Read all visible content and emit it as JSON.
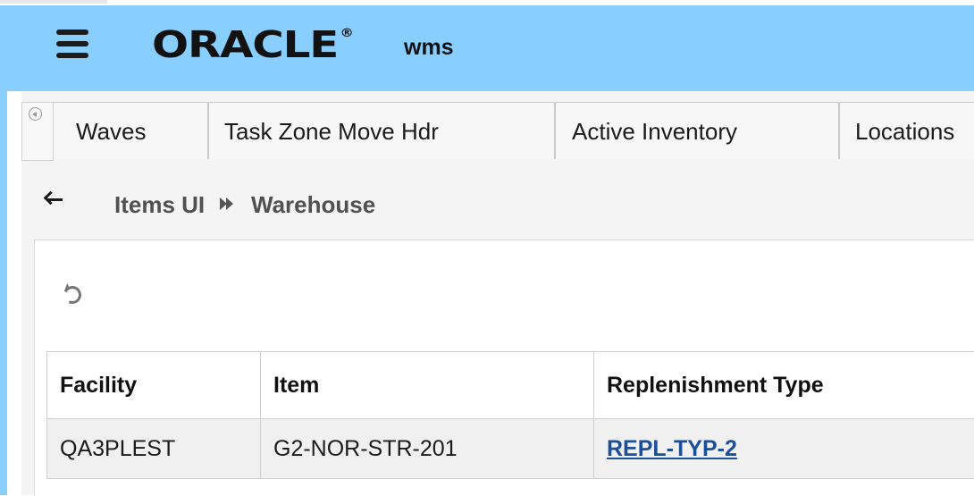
{
  "header": {
    "brand": "ORACLE",
    "brand_mark": "®",
    "app_name": "wms"
  },
  "tabs": [
    {
      "label": "Waves"
    },
    {
      "label": "Task Zone Move Hdr"
    },
    {
      "label": "Active Inventory"
    },
    {
      "label": "Locations"
    }
  ],
  "breadcrumb": {
    "items": [
      "Items UI",
      "Warehouse"
    ]
  },
  "table": {
    "columns": [
      "Facility",
      "Item",
      "Replenishment Type"
    ],
    "rows": [
      {
        "facility": "QA3PLEST",
        "item": "G2-NOR-STR-201",
        "replenishment_type": "REPL-TYP-2"
      }
    ]
  },
  "icons": {
    "menu": "hamburger-menu-icon",
    "tab_back": "circle-back-icon",
    "nav_back": "back-arrow-icon",
    "separator": "double-chevron-right-icon",
    "refresh": "refresh-icon"
  },
  "colors": {
    "header_bg": "#88cfff",
    "link": "#1b4f9c",
    "content_bg": "#f4f4f4"
  }
}
